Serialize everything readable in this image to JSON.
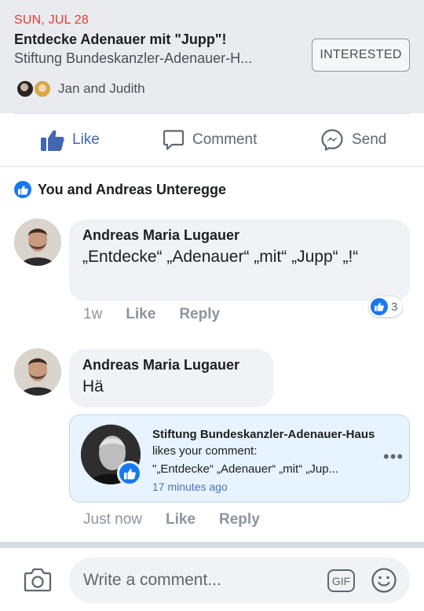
{
  "event": {
    "date": "SUN, JUL 28",
    "title": "Entdecke Adenauer mit \"Jupp\"!",
    "host": "Stiftung Bundeskanzler-Adenauer-H...",
    "interested_label": "INTERESTED",
    "friends_text": "Jan and Judith"
  },
  "actions": {
    "like_label": "Like",
    "comment_label": "Comment",
    "send_label": "Send"
  },
  "reactions": {
    "summary": "You and Andreas Unteregge"
  },
  "comments": [
    {
      "author": "Andreas Maria Lugauer",
      "text": "„Entdecke“ „Adenauer“ „mit“ „Jupp“ „!“",
      "time": "1w",
      "like_label": "Like",
      "reply_label": "Reply",
      "reaction_count": "3"
    },
    {
      "author": "Andreas Maria Lugauer",
      "text": "Hä",
      "time": "Just now",
      "like_label": "Like",
      "reply_label": "Reply"
    }
  ],
  "notification": {
    "actor": "Stiftung Bundeskanzler-Adenauer-Haus",
    "action_text": " likes your comment:",
    "snippet": "\"„Entdecke“ „Adenauer“ „mit“ „Jup...",
    "time": "17 minutes ago",
    "more": "•••"
  },
  "composer": {
    "placeholder": "Write a comment...",
    "gif_label": "GIF"
  },
  "colors": {
    "facebook_blue": "#4267b2",
    "like_blue": "#1877f2",
    "date_red": "#e03c31"
  },
  "icons": [
    "like-thumb-icon",
    "comment-bubble-icon",
    "messenger-icon",
    "camera-icon",
    "gif-icon",
    "emoji-icon",
    "more-dots-icon"
  ]
}
